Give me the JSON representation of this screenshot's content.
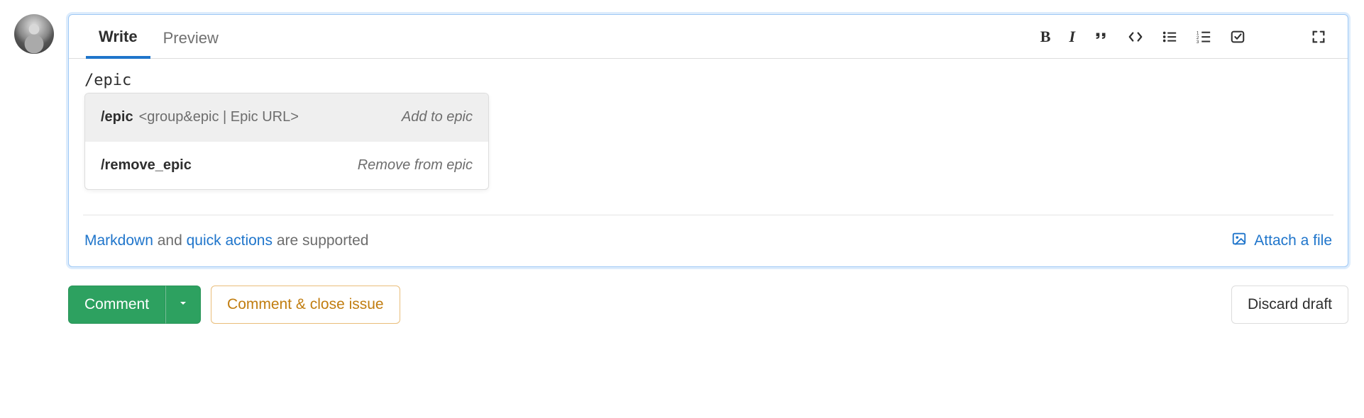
{
  "tabs": {
    "write": "Write",
    "preview": "Preview"
  },
  "editor": {
    "text": "/epic"
  },
  "autocomplete": {
    "items": [
      {
        "cmd": "/epic",
        "params": "<group&epic | Epic URL>",
        "desc": "Add to epic"
      },
      {
        "cmd": "/remove_epic",
        "params": "",
        "desc": "Remove from epic"
      }
    ]
  },
  "footer": {
    "markdown_link": "Markdown",
    "and_text": " and ",
    "quick_actions_link": "quick actions",
    "supported_text": " are supported",
    "attach_label": "Attach a file"
  },
  "buttons": {
    "comment": "Comment",
    "comment_close": "Comment & close issue",
    "discard": "Discard draft"
  }
}
